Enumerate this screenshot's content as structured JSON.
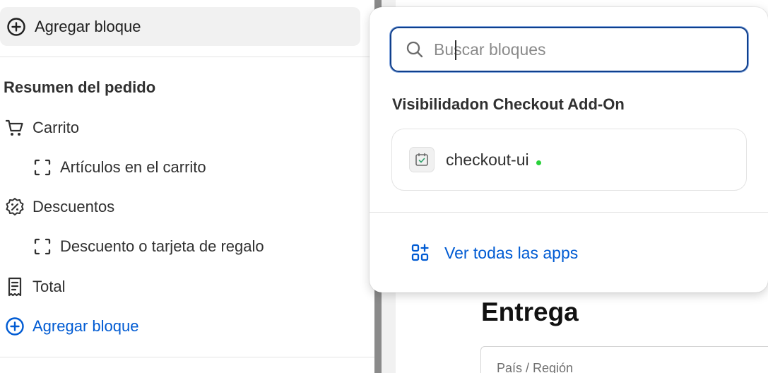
{
  "sidebar": {
    "add_block_top": "Agregar bloque",
    "section_title": "Resumen del pedido",
    "items": [
      {
        "label": "Carrito",
        "icon": "cart-icon"
      },
      {
        "label": "Artículos en el carrito",
        "icon": "block-placeholder-icon"
      },
      {
        "label": "Descuentos",
        "icon": "discount-icon"
      },
      {
        "label": "Descuento o tarjeta de regalo",
        "icon": "block-placeholder-icon"
      },
      {
        "label": "Total",
        "icon": "receipt-icon"
      }
    ],
    "add_block_bottom": "Agregar bloque"
  },
  "preview": {
    "heading": "Entrega",
    "country_label": "País / Región"
  },
  "popover": {
    "search": {
      "placeholder": "Buscar bloques",
      "value": ""
    },
    "group_title": "Visibilidadon Checkout Add-On",
    "app": {
      "name": "checkout-ui",
      "status_color": "#29d13a"
    },
    "view_all": "Ver todas las apps"
  },
  "colors": {
    "link_blue": "#005bd3",
    "focus_border": "#0f3f8c"
  }
}
